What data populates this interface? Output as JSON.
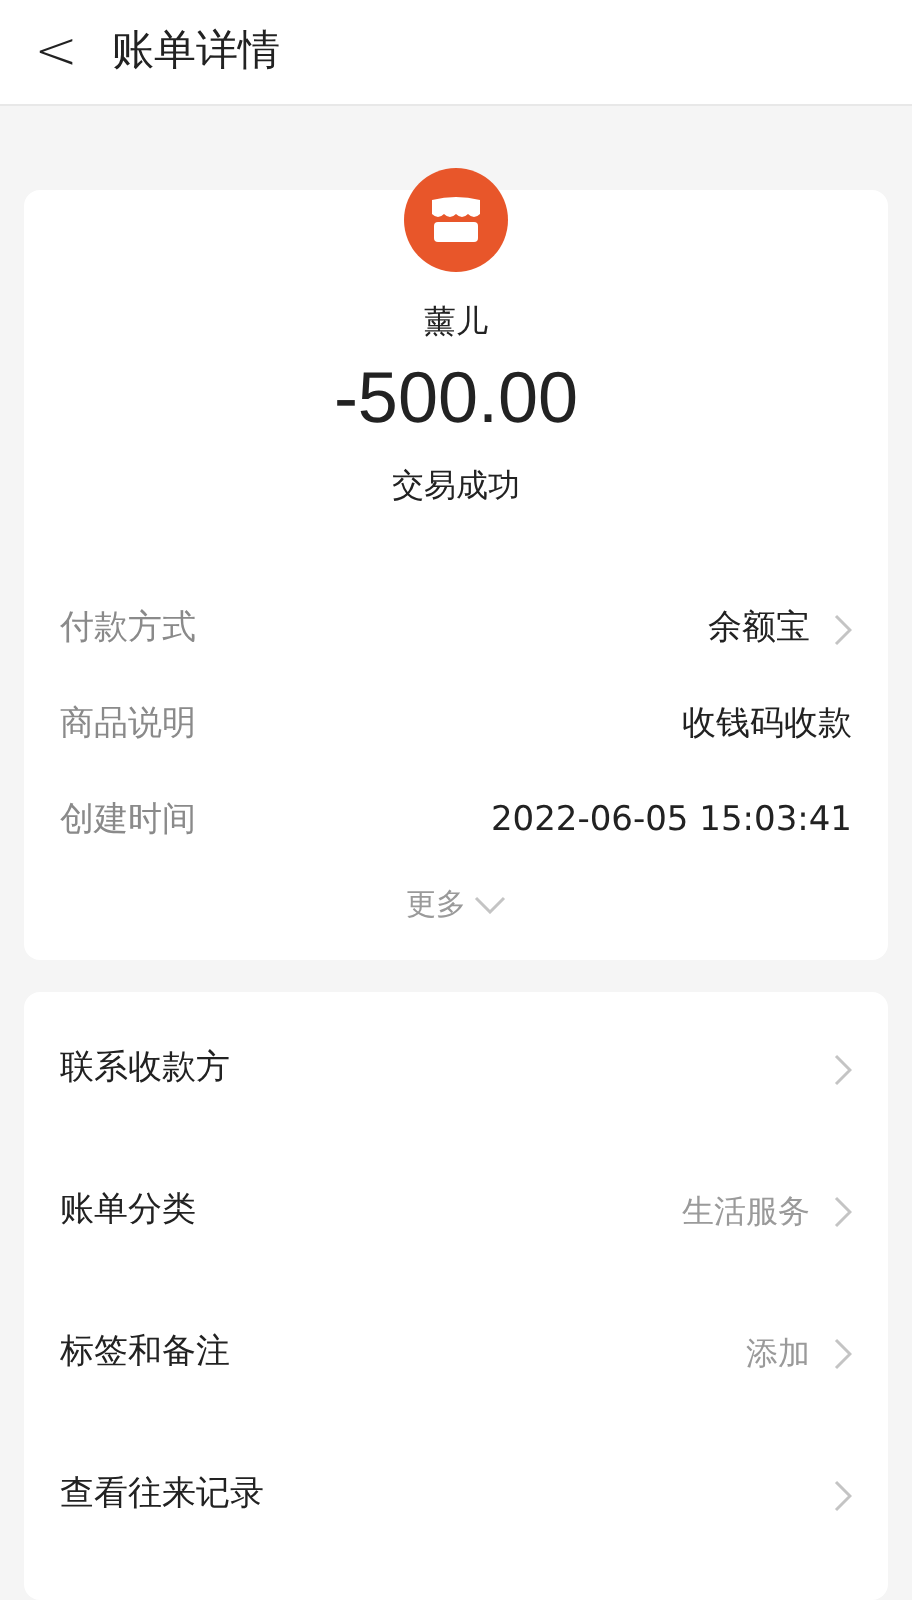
{
  "header": {
    "back": "<",
    "title": "账单详情"
  },
  "summary": {
    "name": "薰儿",
    "amount": "-500.00",
    "status": "交易成功"
  },
  "details": [
    {
      "label": "付款方式",
      "value": "余额宝",
      "has_arrow": true
    },
    {
      "label": "商品说明",
      "value": "收钱码收款",
      "has_arrow": false
    },
    {
      "label": "创建时间",
      "value": "2022-06-05 15:03:41",
      "has_arrow": false
    }
  ],
  "more": "更多",
  "actions": [
    {
      "label": "联系收款方"
    },
    {
      "label": "账单分类",
      "value": "生活服务"
    },
    {
      "label": "标签和备注",
      "value": "添加"
    },
    {
      "label": "查看往来记录"
    }
  ]
}
